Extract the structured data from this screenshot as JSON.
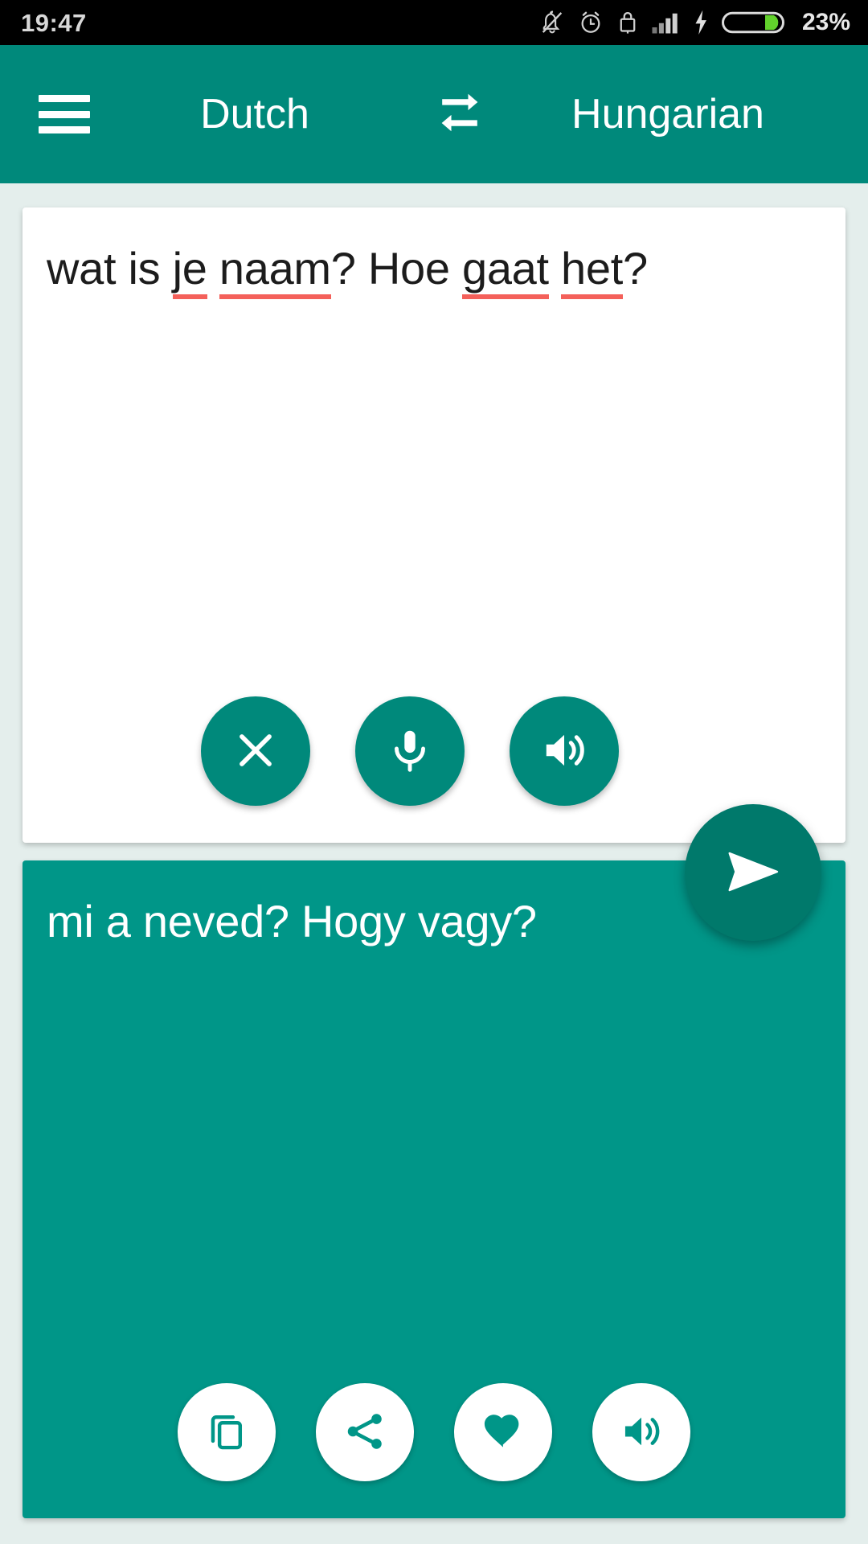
{
  "status_bar": {
    "time": "19:47",
    "battery_percent": "23%",
    "icons": [
      "notifications-off-icon",
      "alarm-icon",
      "lock-icon",
      "signal-icon",
      "charging-bolt-icon",
      "battery-icon"
    ],
    "background_color": "#000000",
    "text_color": "#d8d8d8",
    "battery_fill_color": "#62d22c"
  },
  "header": {
    "menu_label": "menu",
    "source_language": "Dutch",
    "target_language": "Hungarian",
    "swap_icon": "swap-languages-icon",
    "background_color": "#00897b",
    "text_color": "#ffffff"
  },
  "source_card": {
    "text_full": "wat is je naam? Hoe gaat het?",
    "segments": [
      {
        "text": "wat is ",
        "misspelled": false
      },
      {
        "text": "je",
        "misspelled": true
      },
      {
        "text": " ",
        "misspelled": false
      },
      {
        "text": "naam",
        "misspelled": true
      },
      {
        "text": "? Hoe ",
        "misspelled": false
      },
      {
        "text": "gaat",
        "misspelled": true
      },
      {
        "text": " ",
        "misspelled": false
      },
      {
        "text": "het",
        "misspelled": true
      },
      {
        "text": "?",
        "misspelled": false
      }
    ],
    "spellcheck_underline_color": "#f4605a",
    "background_color": "#ffffff",
    "text_color": "#1c1c1c",
    "actions": [
      {
        "name": "clear-button",
        "icon": "close-icon",
        "label": "Clear"
      },
      {
        "name": "microphone-button",
        "icon": "microphone-icon",
        "label": "Speak"
      },
      {
        "name": "speak-source-button",
        "icon": "speaker-icon",
        "label": "Listen"
      }
    ]
  },
  "send_button": {
    "icon": "send-icon",
    "label": "Translate",
    "background_color": "#00796b"
  },
  "target_card": {
    "text": "mi a neved? Hogy vagy?",
    "background_color": "#009688",
    "text_color": "#ffffff",
    "actions": [
      {
        "name": "copy-button",
        "icon": "copy-icon",
        "label": "Copy"
      },
      {
        "name": "share-button",
        "icon": "share-icon",
        "label": "Share"
      },
      {
        "name": "favorite-button",
        "icon": "heart-icon",
        "label": "Favorite"
      },
      {
        "name": "speak-target-button",
        "icon": "speaker-icon",
        "label": "Listen"
      }
    ]
  },
  "page": {
    "background_color": "#e4eeec"
  }
}
